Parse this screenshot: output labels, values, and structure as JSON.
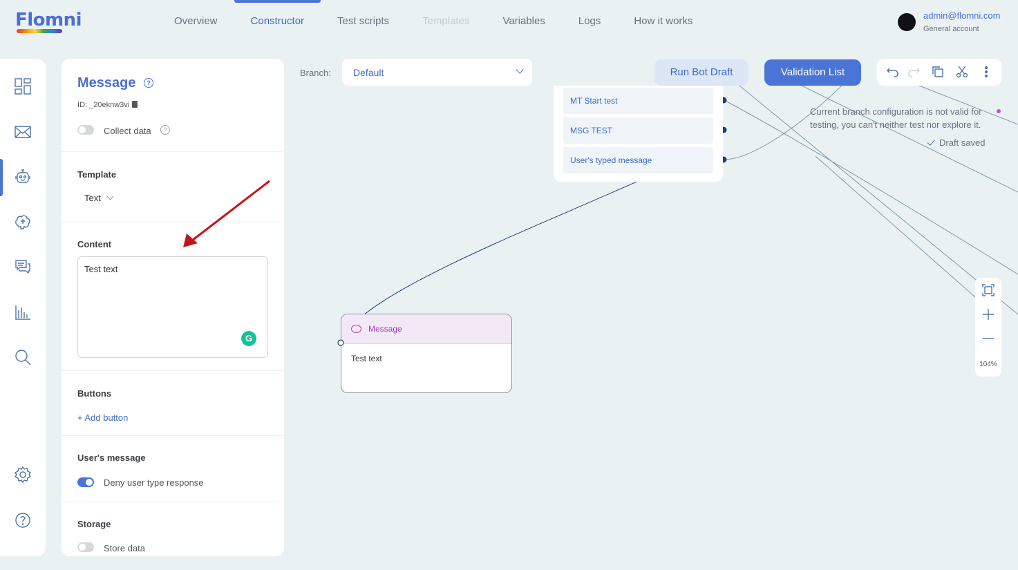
{
  "brand": {
    "logo": "Flomni"
  },
  "nav": [
    "Overview",
    "Constructor",
    "Test scripts",
    "Templates",
    "Variables",
    "Logs",
    "How it works"
  ],
  "account": {
    "email": "admin@flomni.com",
    "type": "General account"
  },
  "panel": {
    "title": "Message",
    "id_text": "ID: _20eknw3vi",
    "collect_label": "Collect data",
    "template_heading": "Template",
    "template_value": "Text",
    "content_heading": "Content",
    "content_value": "Test text",
    "grammarly": "G",
    "buttons_heading": "Buttons",
    "add_button": "+ Add button",
    "user_msg_heading": "User's message",
    "deny_label": "Deny user type response",
    "storage_heading": "Storage",
    "store_label": "Store data"
  },
  "canvas": {
    "branch_label": "Branch:",
    "branch_value": "Default",
    "run_draft": "Run Bot Draft",
    "validation": "Validation List",
    "options": [
      "MT Start test",
      "MSG TEST",
      "User's typed message"
    ],
    "message_node_title": "Message",
    "message_node_text": "Test text",
    "status": "Current branch configuration is not valid for testing, you can't neither test nor explore it.",
    "saved": "Draft saved",
    "zoom": "104%"
  },
  "colors": {
    "accent": "#4a74d6",
    "background": "#eaf1f3",
    "message_purple": "#a440c0",
    "arrow": "#c0161a"
  }
}
